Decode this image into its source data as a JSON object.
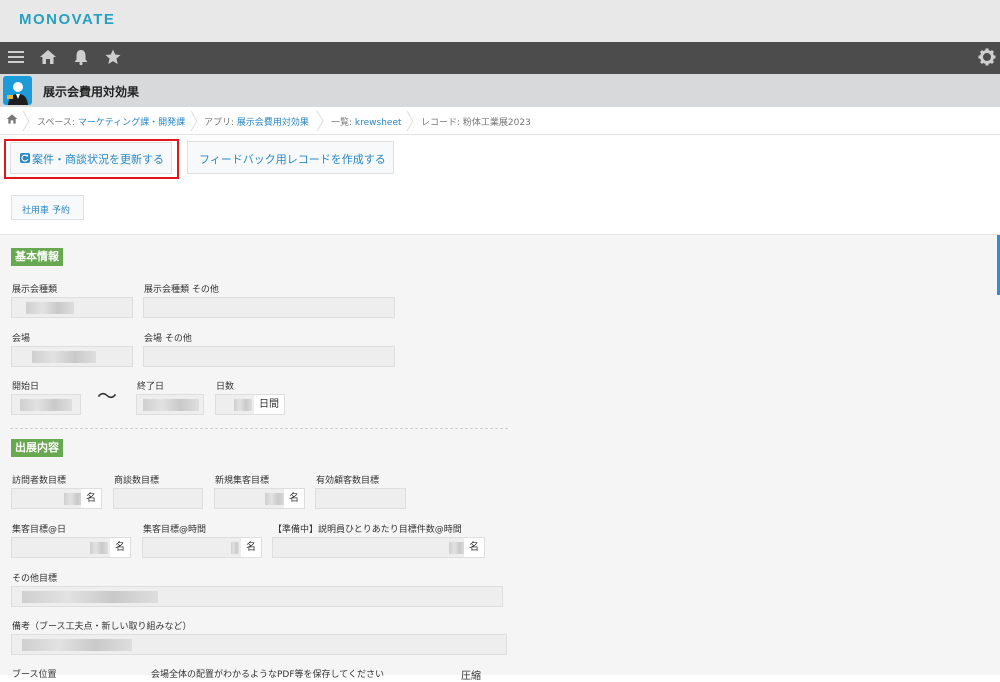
{
  "brand": {
    "logo": "MONOVATE"
  },
  "nav": {
    "menu_icon": "menu-icon",
    "home_icon": "home-icon",
    "bell_icon": "bell-icon",
    "star_icon": "star-icon",
    "settings_icon": "gear-icon"
  },
  "app": {
    "title": "展示会費用対効果"
  },
  "breadcrumb": {
    "space_prefix": "スペース:",
    "space": "マーケティング課・開発課",
    "app_prefix": "アプリ:",
    "app": "展示会費用対効果",
    "list_prefix": "一覧:",
    "list": "krewsheet",
    "record": "レコード: 粉体工業展2023"
  },
  "actions": {
    "update_status": "案件・商談状況を更新する",
    "create_feedback": "フィードバック用レコードを作成する",
    "car_reservation": "社用車 予約"
  },
  "colors": {
    "accent": "#2987c6",
    "section": "#67a850",
    "highlight": "#e0171b"
  },
  "sections": {
    "basic": {
      "title": "基本情報",
      "exhibition_type": "展示会種類",
      "exhibition_type_other": "展示会種類 その他",
      "venue": "会場",
      "venue_other": "会場 その他",
      "start_date": "開始日",
      "tilde": "〜",
      "end_date": "終了日",
      "days": "日数",
      "days_unit": "日間"
    },
    "exhibit": {
      "title": "出展内容",
      "visitor_target": "訪問者数目標",
      "visitor_unit": "名",
      "negotiation_target": "商談数目標",
      "new_customer_target": "新規集客目標",
      "new_customer_unit": "名",
      "effective_customer_target": "有効顧客数目標",
      "daily_target": "集客目標@日",
      "daily_unit": "名",
      "hourly_target": "集客目標@時間",
      "hourly_unit": "名",
      "staff_target": "【準備中】説明員ひとりあたり目標件数@時間",
      "staff_unit": "名",
      "other_target": "その他目標",
      "remarks": "備考（ブース工夫点・新しい取り組みなど）",
      "booth_position": "ブース位置",
      "layout_pdf": "会場全体の配置がわかるようなPDF等を保存してください",
      "compression": "圧縮"
    }
  }
}
